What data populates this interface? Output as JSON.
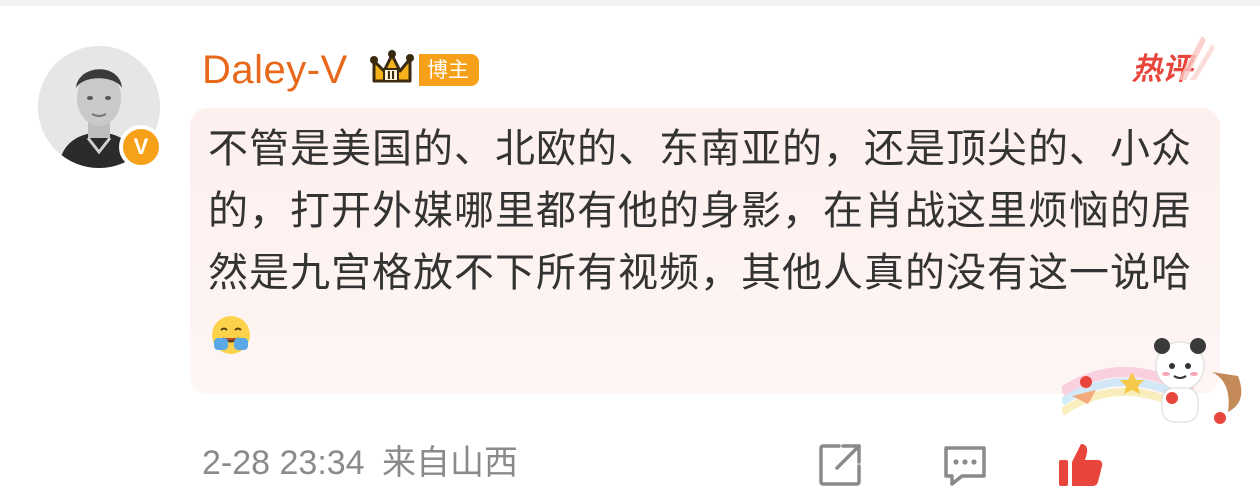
{
  "comment": {
    "username": "Daley-V",
    "badge_label": "博主",
    "hot_label": "热评",
    "text": "不管是美国的、北欧的、东南亚的，还是顶尖的、小众的，打开外媒哪里都有他的身影，在肖战这里烦恼的居然是九宫格放不下所有视频，其他人真的没有这一说哈",
    "emoji": "smiling-face-icon",
    "verified_badge": "V",
    "timestamp": "2-28 23:34",
    "location": "来自山西"
  },
  "colors": {
    "username": "#e8691b",
    "badge": "#f7a11a",
    "hot": "#e8463c",
    "bubble": "#fdf1ef",
    "text": "#333333",
    "meta": "#8a8a8a"
  },
  "icons": {
    "share": "share-icon",
    "reply": "comment-icon",
    "like": "like-icon"
  }
}
